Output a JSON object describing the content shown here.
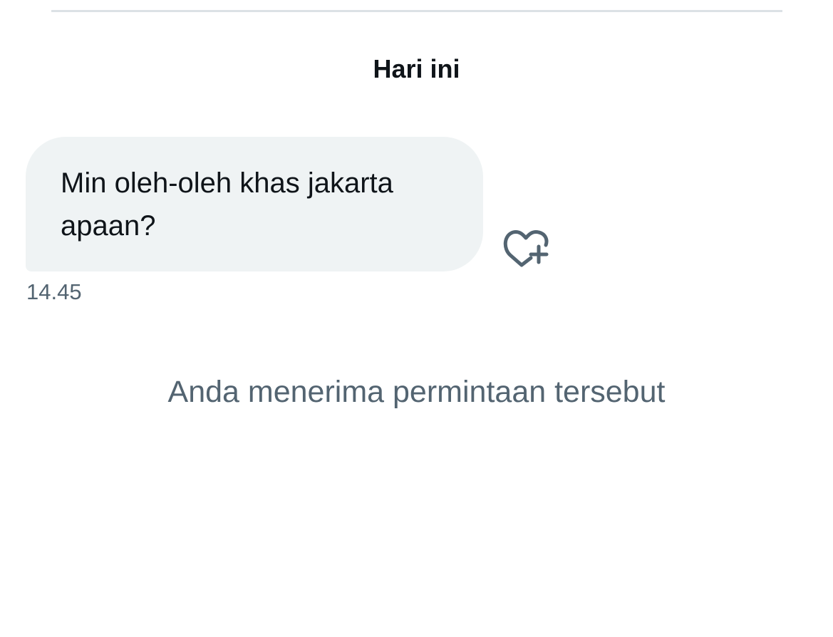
{
  "conversation": {
    "date_separator": "Hari ini",
    "messages": [
      {
        "text": "Min oleh-oleh khas jakarta\napaan?",
        "timestamp": "14.45",
        "reaction_icon": "heart-plus-icon"
      }
    ],
    "status": "Anda menerima permintaan tersebut"
  },
  "colors": {
    "bubble_background": "#eff3f4",
    "primary_text": "#0f1419",
    "secondary_text": "#536471",
    "divider": "#dce1e5"
  }
}
